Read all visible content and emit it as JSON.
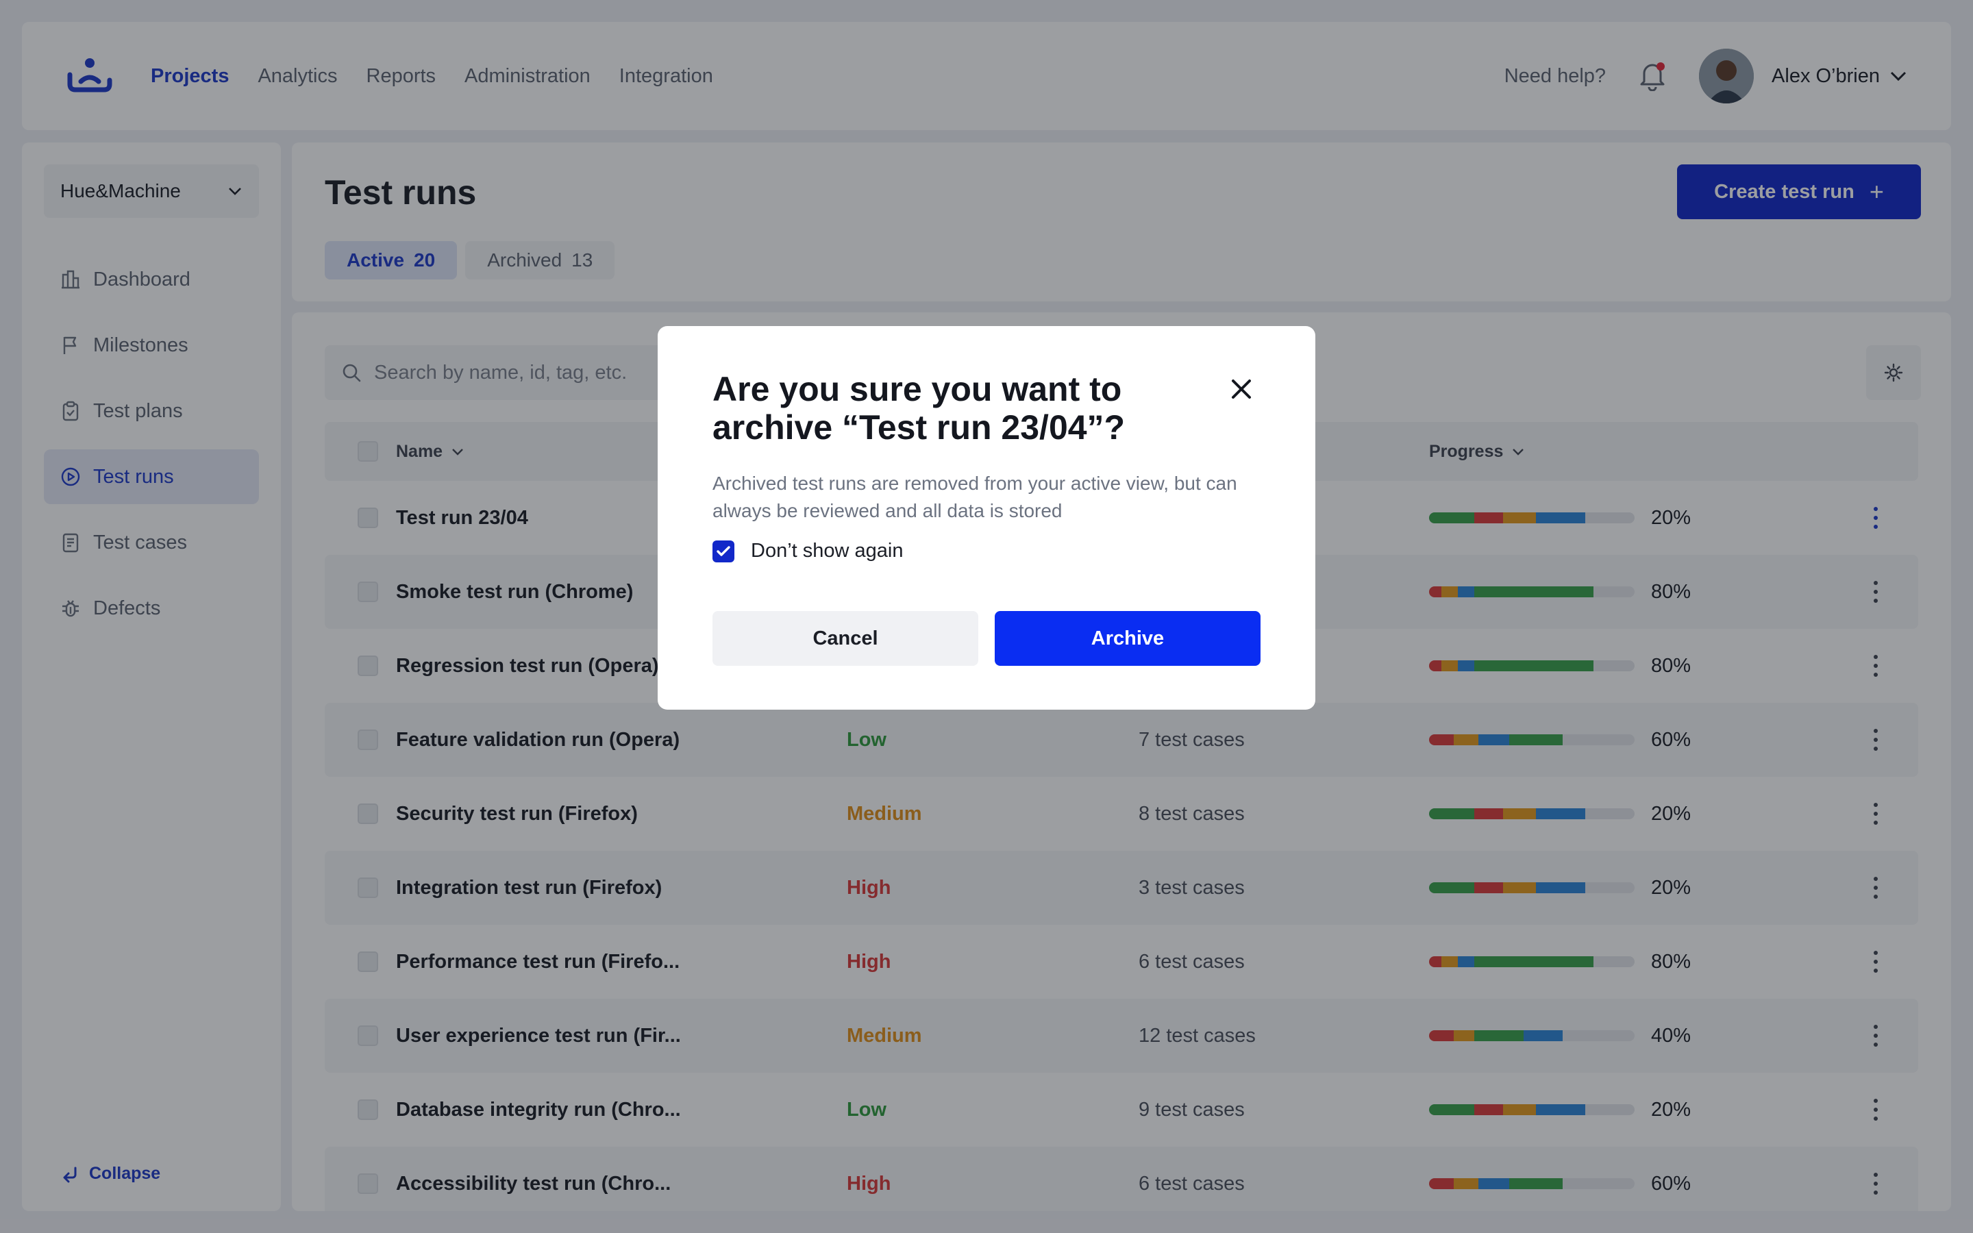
{
  "topbar": {
    "logo_icon": "logo-icon",
    "nav": [
      {
        "label": "Projects",
        "active": true
      },
      {
        "label": "Analytics",
        "active": false
      },
      {
        "label": "Reports",
        "active": false
      },
      {
        "label": "Administration",
        "active": false
      },
      {
        "label": "Integration",
        "active": false
      }
    ],
    "help_label": "Need help?",
    "user_name": "Alex O’brien"
  },
  "sidebar": {
    "workspace": "Hue&Machine",
    "items": [
      {
        "label": "Dashboard",
        "icon": "dashboard-icon"
      },
      {
        "label": "Milestones",
        "icon": "flag-icon"
      },
      {
        "label": "Test plans",
        "icon": "clipboard-icon"
      },
      {
        "label": "Test runs",
        "icon": "play-circle-icon",
        "active": true
      },
      {
        "label": "Test cases",
        "icon": "document-icon"
      },
      {
        "label": "Defects",
        "icon": "bug-icon"
      }
    ],
    "collapse_label": "Collapse"
  },
  "header": {
    "title": "Test runs",
    "tabs": [
      {
        "label": "Active",
        "count": "20",
        "active": true
      },
      {
        "label": "Archived",
        "count": "13",
        "active": false
      }
    ],
    "create_label": "Create test run"
  },
  "table": {
    "search_placeholder": "Search by name, id, tag, etc.",
    "columns": {
      "name": "Name",
      "progress": "Progress"
    },
    "rows": [
      {
        "name": "Test run 23/04",
        "priority": "",
        "cases": "",
        "progress": "20%",
        "segments": [
          [
            "#3aa14a",
            22
          ],
          [
            "#d93c3c",
            14
          ],
          [
            "#e39a1e",
            16
          ],
          [
            "#2e86d8",
            24
          ]
        ]
      },
      {
        "name": "Smoke test run (Chrome)",
        "priority": "",
        "cases": "",
        "progress": "80%",
        "segments": [
          [
            "#d93c3c",
            6
          ],
          [
            "#e39a1e",
            8
          ],
          [
            "#2e86d8",
            8
          ],
          [
            "#3aa14a",
            58
          ]
        ]
      },
      {
        "name": "Regression test run (Opera)",
        "priority": "",
        "cases": "",
        "progress": "80%",
        "segments": [
          [
            "#d93c3c",
            6
          ],
          [
            "#e39a1e",
            8
          ],
          [
            "#2e86d8",
            8
          ],
          [
            "#3aa14a",
            58
          ]
        ]
      },
      {
        "name": "Feature validation run (Opera)",
        "priority": "Low",
        "cases": "7 test cases",
        "progress": "60%",
        "segments": [
          [
            "#d93c3c",
            12
          ],
          [
            "#e39a1e",
            12
          ],
          [
            "#2e86d8",
            15
          ],
          [
            "#3aa14a",
            26
          ]
        ]
      },
      {
        "name": "Security test run (Firefox)",
        "priority": "Medium",
        "cases": "8 test cases",
        "progress": "20%",
        "segments": [
          [
            "#3aa14a",
            22
          ],
          [
            "#d93c3c",
            14
          ],
          [
            "#e39a1e",
            16
          ],
          [
            "#2e86d8",
            24
          ]
        ]
      },
      {
        "name": "Integration test run (Firefox)",
        "priority": "High",
        "cases": "3 test cases",
        "progress": "20%",
        "segments": [
          [
            "#3aa14a",
            22
          ],
          [
            "#d93c3c",
            14
          ],
          [
            "#e39a1e",
            16
          ],
          [
            "#2e86d8",
            24
          ]
        ]
      },
      {
        "name": "Performance test run (Firefo...",
        "priority": "High",
        "cases": "6 test cases",
        "progress": "80%",
        "segments": [
          [
            "#d93c3c",
            6
          ],
          [
            "#e39a1e",
            8
          ],
          [
            "#2e86d8",
            8
          ],
          [
            "#3aa14a",
            58
          ]
        ]
      },
      {
        "name": "User experience test run (Fir...",
        "priority": "Medium",
        "cases": "12 test cases",
        "progress": "40%",
        "segments": [
          [
            "#d93c3c",
            12
          ],
          [
            "#e39a1e",
            10
          ],
          [
            "#3aa14a",
            24
          ],
          [
            "#2e86d8",
            19
          ]
        ]
      },
      {
        "name": "Database integrity run (Chro...",
        "priority": "Low",
        "cases": "9 test cases",
        "progress": "20%",
        "segments": [
          [
            "#3aa14a",
            22
          ],
          [
            "#d93c3c",
            14
          ],
          [
            "#e39a1e",
            16
          ],
          [
            "#2e86d8",
            24
          ]
        ]
      },
      {
        "name": "Accessibility test run (Chro...",
        "priority": "High",
        "cases": "6 test cases",
        "progress": "60%",
        "segments": [
          [
            "#d93c3c",
            12
          ],
          [
            "#e39a1e",
            12
          ],
          [
            "#2e86d8",
            15
          ],
          [
            "#3aa14a",
            26
          ]
        ]
      }
    ]
  },
  "modal": {
    "title": "Are you sure you want to archive “Test run 23/04”?",
    "body": "Archived test runs are removed from your active view, but can always be reviewed and all data is stored",
    "checkbox_label": "Don’t show again",
    "checkbox_checked": true,
    "cancel_label": "Cancel",
    "archive_label": "Archive"
  },
  "colors": {
    "brand": "#1228c9",
    "archive_button": "#0a2df2",
    "low": "#2f9a3d",
    "medium": "#e0901b",
    "high": "#d73a3a"
  }
}
